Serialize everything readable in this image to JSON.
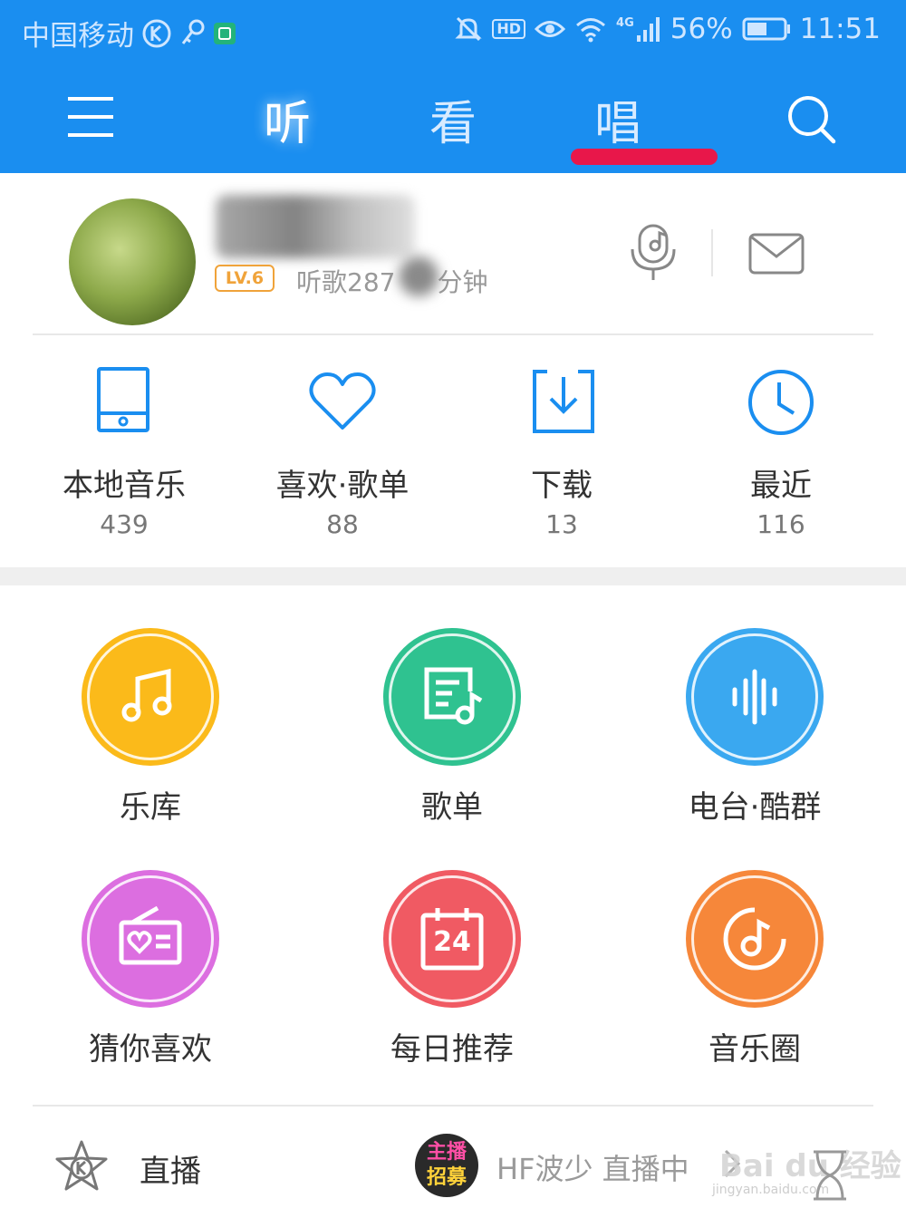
{
  "status_bar": {
    "carrier": "中国移动",
    "icons_left": [
      "k-circle-icon",
      "key-icon",
      "app-green-icon"
    ],
    "icons_right": [
      "mute-icon",
      "hd-icon",
      "eye-icon",
      "wifi-icon",
      "signal-icon",
      "battery-icon"
    ],
    "hd_label": "HD",
    "network_label": "4G",
    "battery_percent": "56%",
    "battery_level": 0.56,
    "time": "11:51"
  },
  "nav": {
    "tabs": [
      {
        "label": "听"
      },
      {
        "label": "看"
      },
      {
        "label": "唱"
      }
    ],
    "active_tab": "听",
    "highlighted_tab": "唱"
  },
  "profile": {
    "level": "LV.6",
    "listen_prefix": "听歌287",
    "listen_suffix": "分钟"
  },
  "quick": {
    "items": [
      {
        "label": "本地音乐",
        "count": "439",
        "icon": "tablet-icon"
      },
      {
        "label": "喜欢·歌单",
        "count": "88",
        "icon": "heart-icon"
      },
      {
        "label": "下载",
        "count": "13",
        "icon": "download-icon"
      },
      {
        "label": "最近",
        "count": "116",
        "icon": "clock-icon"
      }
    ]
  },
  "features": {
    "items": [
      {
        "label": "乐库",
        "icon": "music-note-icon",
        "color": "#fbba1a"
      },
      {
        "label": "歌单",
        "icon": "playlist-icon",
        "color": "#2fc290"
      },
      {
        "label": "电台·酷群",
        "icon": "soundwave-icon",
        "color": "#3aa8f0"
      },
      {
        "label": "猜你喜欢",
        "icon": "radio-heart-icon",
        "color": "#dc6ee0"
      },
      {
        "label": "每日推荐",
        "icon": "calendar-icon",
        "color": "#f05a63",
        "calendar_day": "24"
      },
      {
        "label": "音乐圈",
        "icon": "music-disc-icon",
        "color": "#f6873a"
      }
    ]
  },
  "live": {
    "label": "直播",
    "anchor_badge_line1": "主播",
    "anchor_badge_line2": "招募",
    "anchor_text": "HF波少 直播中"
  },
  "watermark": {
    "main": "Bai du 经验",
    "sub": "jingyan.baidu.com"
  },
  "colors": {
    "header_blue": "#1a8ef0",
    "tab_underline": "#e8174a",
    "icon_blue": "#1a8ef0"
  }
}
